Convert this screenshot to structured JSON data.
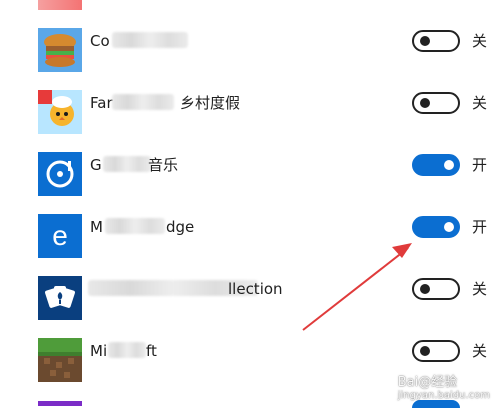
{
  "apps": [
    {
      "id": "cooking",
      "name_visible": "Co",
      "state_label": "关",
      "toggle_on": false,
      "icon": "burger-icon"
    },
    {
      "id": "farm",
      "name_visible_left": "Far",
      "name_visible_right": "乡村度假",
      "state_label": "关",
      "toggle_on": false,
      "icon": "chef-chick-icon"
    },
    {
      "id": "music",
      "name_visible_left": "G",
      "name_visible_right": "音乐",
      "state_label": "开",
      "toggle_on": true,
      "icon": "music-disc-icon"
    },
    {
      "id": "edge",
      "name_visible_left": "M",
      "name_visible_right": "dge",
      "state_label": "开",
      "toggle_on": true,
      "icon": "edge-browser-icon"
    },
    {
      "id": "solitaire",
      "name_visible_right": "llection",
      "state_label": "关",
      "toggle_on": false,
      "icon": "cards-icon"
    },
    {
      "id": "minecraft",
      "name_visible_left": "Mi",
      "name_visible_right": "ft",
      "state_label": "关",
      "toggle_on": false,
      "icon": "minecraft-block-icon"
    }
  ],
  "watermark": {
    "text_line1": "Bai@经验",
    "text_line2": "jingyan.baidu.com"
  },
  "colors": {
    "toggle_on": "#0b6ed1",
    "toggle_off_border": "#222222",
    "icon_blue": "#0b6ed1",
    "arrow": "#e03b3b"
  }
}
